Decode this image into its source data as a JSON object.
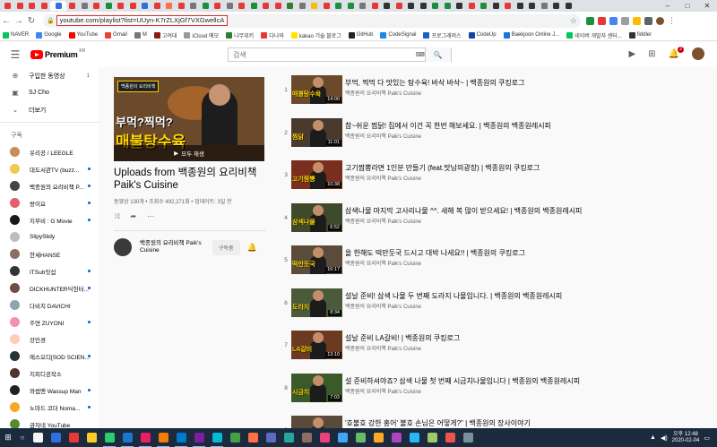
{
  "browser": {
    "url": "youtube.com/playlist?list=UUyn-K7rZLXjGf7VXGwellcA",
    "bookmarks": [
      "NAVER",
      "Google",
      "YouTube",
      "Gmail",
      "M",
      "고려대",
      "iCloud 메모",
      "나무위키",
      "다나와",
      "kakao 기술 블로그",
      "GitHub",
      "CodeSignal",
      "프로그래머스",
      "CodeUp",
      "Baekjoon Online J...",
      "네이버 개발자 센터...",
      "fiddler"
    ],
    "colors": {
      "url_highlight_border": "#d93025"
    }
  },
  "masthead": {
    "logo_text": "Premium",
    "logo_region": "KR",
    "search_placeholder": "검색",
    "notification_count": "2"
  },
  "sidebar": {
    "top_items": [
      {
        "icon": "purchase-icon",
        "label": "구입한 동영상",
        "count": "1"
      },
      {
        "icon": "channel-icon",
        "label": "SJ Cho",
        "count": ""
      },
      {
        "icon": "chevron-down-icon",
        "label": "더보기",
        "count": ""
      }
    ],
    "section_title": "구독",
    "subscriptions": [
      {
        "name": "유리공 / LEEGLE",
        "color": "#c98c5a",
        "dot": false
      },
      {
        "name": "대도서관TV (buzz...",
        "color": "#f2c94c",
        "dot": true
      },
      {
        "name": "백종원의 요리비책 P...",
        "color": "#444444",
        "dot": true
      },
      {
        "name": "랑이요",
        "color": "#e35d6a",
        "dot": true
      },
      {
        "name": "지무비 : G Movie",
        "color": "#1a1a1a",
        "dot": true
      },
      {
        "name": "SlipySlidy",
        "color": "#bdbdbd",
        "dot": false
      },
      {
        "name": "한세HANSE",
        "color": "#8d6e63",
        "dot": false
      },
      {
        "name": "ITSub잇섭",
        "color": "#333333",
        "dot": true
      },
      {
        "name": "DICKHUNTER딕헌터...",
        "color": "#6d4c41",
        "dot": true
      },
      {
        "name": "다비치 DAVICHI",
        "color": "#90a4ae",
        "dot": false
      },
      {
        "name": "주연 ZUYONI",
        "color": "#f48fb1",
        "dot": true
      },
      {
        "name": "강민경",
        "color": "#ffccbc",
        "dot": false
      },
      {
        "name": "에스오디[SOD SCIEN...",
        "color": "#263238",
        "dot": true
      },
      {
        "name": "지피디공작소",
        "color": "#4e342e",
        "dot": false
      },
      {
        "name": "와썹맨 Wassup Man",
        "color": "#212121",
        "dot": true
      },
      {
        "name": "노마드 코더 Noma...",
        "color": "#f9a825",
        "dot": true
      },
      {
        "name": "금자네 YouTube",
        "color": "#558b2f",
        "dot": false
      }
    ]
  },
  "playlist": {
    "thumb_text_top": "부먹?찍먹?",
    "thumb_text_main": "매불탕수육",
    "thumb_badge": "백종원의 요리비책",
    "play_all": "모두 재생",
    "title": "Uploads from 백종원의 요리비책 Paik's Cuisine",
    "meta": "동영상 130개 • 조회수 492,271회 • 업데이트: 3일 전",
    "owner_name": "백종원의 요리비책 Paik's Cuisine",
    "subscribe_label": "구독중"
  },
  "videos": [
    {
      "idx": "1",
      "title": "부먹, 찍먹 다 맛있는 탕수육! 바삭 바삭~ | 백종원의 쿠킹로그",
      "channel": "백종원의 요리비책 Paik's Cuisine",
      "duration": "14:00",
      "thumb_text": "매불탕수육",
      "bg": "#6b4a2c"
    },
    {
      "idx": "2",
      "title": "참~쉬운 찜닭! 집에서 이건 꼭 한번 해보세요. | 백종원의 백종원레시피",
      "channel": "백종원의 요리비책 Paik's Cuisine",
      "duration": "11:01",
      "thumb_text": "찜닭",
      "bg": "#4a3a2e"
    },
    {
      "idx": "3",
      "title": "고기짬뽕라면 1인분 만들기 (feat.맛남의광장) | 백종원의 쿠킹로그",
      "channel": "백종원의 요리비책 Paik's Cuisine",
      "duration": "10:38",
      "thumb_text": "고기짬뽕",
      "bg": "#7a2e1e"
    },
    {
      "idx": "4",
      "title": "삼색나물 마지막 고사리나물 ^^. 새해 복 많이 받으세요! | 백종원의 백종원레시피",
      "channel": "백종원의 요리비책 Paik's Cuisine",
      "duration": "6:52",
      "thumb_text": "삼색나물",
      "bg": "#3e4a2a"
    },
    {
      "idx": "5",
      "title": "올 한해도 떡만둣국 드시고 대박 나세요!! | 백종원의 쿠킹로그",
      "channel": "백종원의 요리비책 Paik's Cuisine",
      "duration": "16:17",
      "thumb_text": "떡만둣국",
      "bg": "#5b4b3b"
    },
    {
      "idx": "6",
      "title": "설날 준비! 삼색 나물 두 번째 도라지 나물입니다. | 백종원의 백종원레시피",
      "channel": "백종원의 요리비책 Paik's Cuisine",
      "duration": "8:34",
      "thumb_text": "도라지",
      "bg": "#4b5a3a"
    },
    {
      "idx": "7",
      "title": "설날 준비 LA갈비! | 백종원의 쿠킹로그",
      "channel": "백종원의 요리비책 Paik's Cuisine",
      "duration": "13:10",
      "thumb_text": "LA갈비",
      "bg": "#6a3a22"
    },
    {
      "idx": "8",
      "title": "설 준비하셔야죠? 삼색 나물 첫 번째 시금치나물입니다 | 백종원의 백종원레시피",
      "channel": "백종원의 요리비책 Paik's Cuisine",
      "duration": "7:03",
      "thumb_text": "시금치",
      "bg": "#3a5a2a"
    },
    {
      "idx": "9",
      "title": "'호불호 강한 홍어' 불호 손님은 어떻게?\" | 백종원의 장사이야기",
      "channel": "",
      "duration": "",
      "thumb_text": "",
      "bg": "#5a4a3a"
    }
  ],
  "taskbar": {
    "time": "오후 12:48",
    "date": "2020-02-04",
    "apps": [
      "#f5f5f5",
      "#2f6fe0",
      "#e53935",
      "#ffca28",
      "#2ecc71",
      "#1976d2",
      "#e91e63",
      "#f57c00",
      "#007acc",
      "#7b1fa2",
      "#00bcd4",
      "#43a047",
      "#ff7043",
      "#5c6bc0",
      "#26a69a",
      "#8d6e63",
      "#ec407a",
      "#42a5f5",
      "#66bb6a",
      "#ffa726",
      "#ab47bc",
      "#29b6f6",
      "#9ccc65",
      "#ef5350",
      "#78909c"
    ]
  }
}
